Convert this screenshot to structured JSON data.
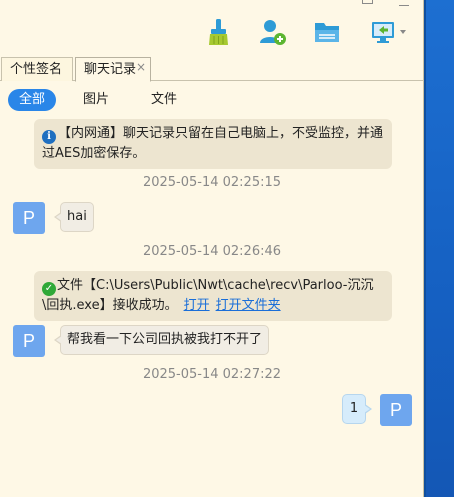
{
  "toolbar": {
    "icons": [
      "brush-icon",
      "add-contact-icon",
      "folder-icon",
      "screen-share-icon"
    ]
  },
  "tabs": [
    {
      "label": "个性签名"
    },
    {
      "label": "聊天记录",
      "close": "×"
    }
  ],
  "filters": [
    {
      "label": "全部"
    },
    {
      "label": "图片"
    },
    {
      "label": "文件"
    }
  ],
  "messages": {
    "system_notice": "【内网通】聊天记录只留在自己电脑上，不受监控，并通过AES加密保存。",
    "ts1": "2025-05-14 02:25:15",
    "msg1_avatar": "P",
    "msg1_text": "hai",
    "ts2": "2025-05-14 02:26:46",
    "file_notice": "文件【C:\\Users\\Public\\Nwt\\cache\\recv\\Parloo-沉沉\\回执.exe】接收成功。",
    "file_open": "打开",
    "file_open_folder": "打开文件夹",
    "msg2_avatar": "P",
    "msg2_text": "帮我看一下公司回执被我打不开了",
    "ts3": "2025-05-14 02:27:22",
    "msg3_avatar": "P",
    "msg3_text": "1"
  },
  "colors": {
    "accent": "#2a86e8",
    "avatar": "#6ea6ee",
    "background": "#fef8e6",
    "link": "#1a6ed8"
  }
}
